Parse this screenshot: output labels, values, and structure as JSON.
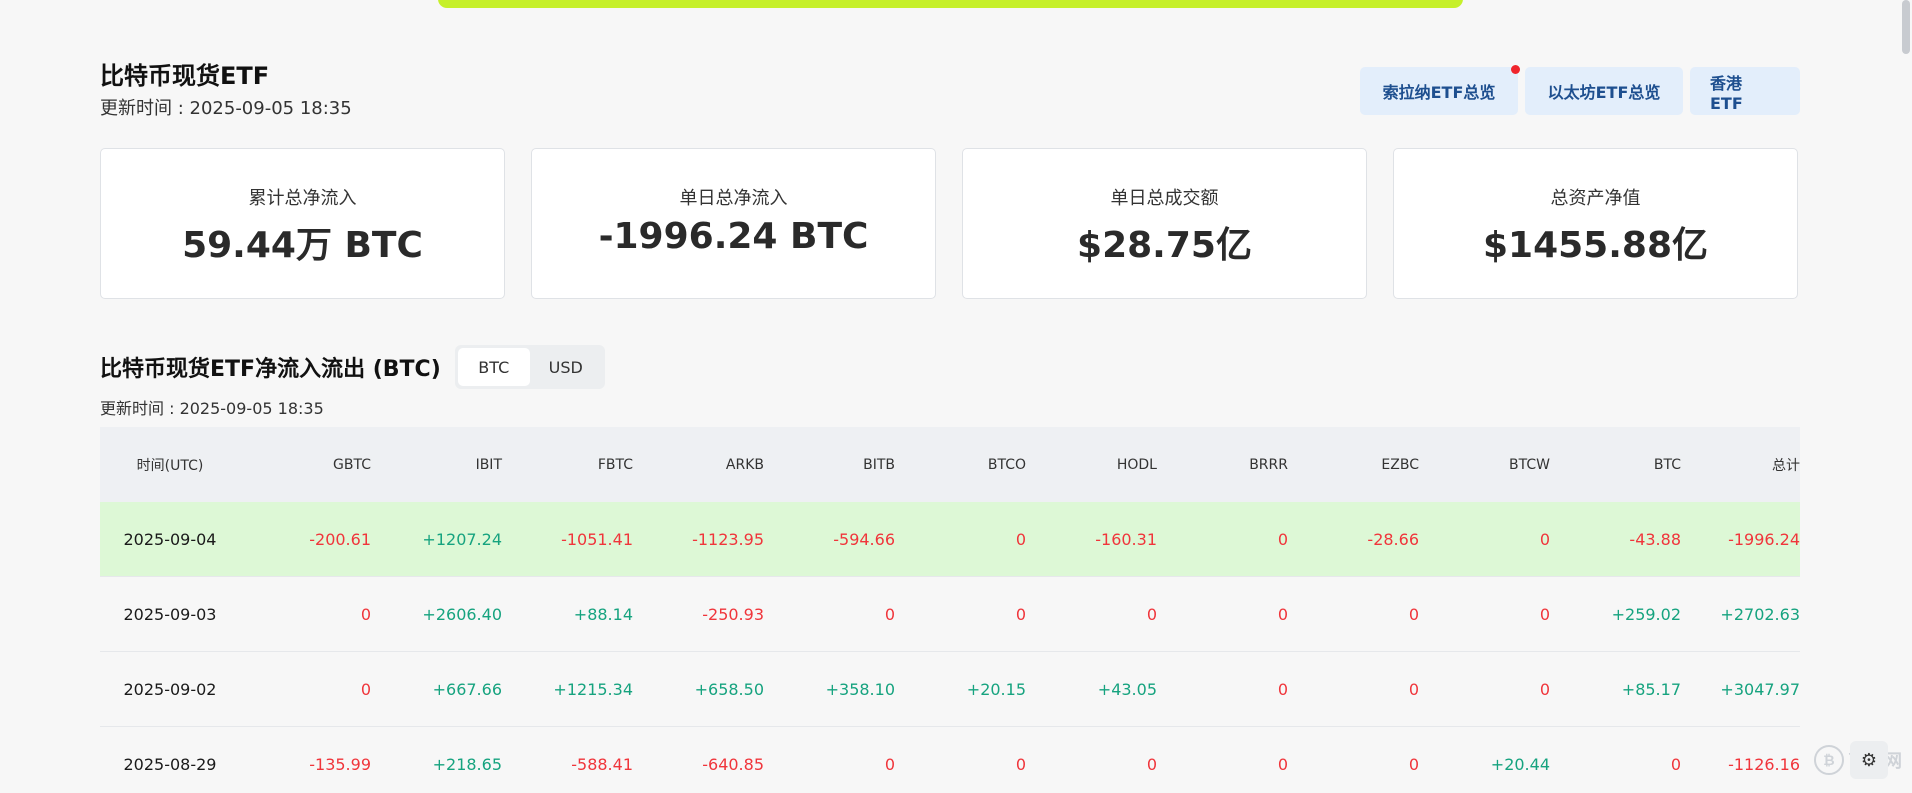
{
  "header": {
    "title": "比特币现货ETF",
    "update_time": "更新时间 : 2025-09-05 18:35"
  },
  "nav": {
    "solana": "索拉纳ETF总览",
    "ethereum": "以太坊ETF总览",
    "hongkong": "香港 ETF"
  },
  "stats": [
    {
      "label": "累计总净流入",
      "value": "59.44万 BTC"
    },
    {
      "label": "单日总净流入",
      "value": "-1996.24 BTC"
    },
    {
      "label": "单日总成交额",
      "value": "$28.75亿"
    },
    {
      "label": "总资产净值",
      "value": "$1455.88亿"
    }
  ],
  "section": {
    "title": "比特币现货ETF净流入流出 (BTC)",
    "toggle_btc": "BTC",
    "toggle_usd": "USD",
    "update_time": "更新时间 : 2025-09-05 18:35"
  },
  "table": {
    "headers": [
      "时间(UTC)",
      "GBTC",
      "IBIT",
      "FBTC",
      "ARKB",
      "BITB",
      "BTCO",
      "HODL",
      "BRRR",
      "EZBC",
      "BTCW",
      "BTC",
      "总计"
    ],
    "rows": [
      [
        "2025-09-04",
        "-200.61",
        "+1207.24",
        "-1051.41",
        "-1123.95",
        "-594.66",
        "0",
        "-160.31",
        "0",
        "-28.66",
        "0",
        "-43.88",
        "-1996.24"
      ],
      [
        "2025-09-03",
        "0",
        "+2606.40",
        "+88.14",
        "-250.93",
        "0",
        "0",
        "0",
        "0",
        "0",
        "0",
        "+259.02",
        "+2702.63"
      ],
      [
        "2025-09-02",
        "0",
        "+667.66",
        "+1215.34",
        "+658.50",
        "+358.10",
        "+20.15",
        "+43.05",
        "0",
        "0",
        "0",
        "+85.17",
        "+3047.97"
      ],
      [
        "2025-08-29",
        "-135.99",
        "+218.65",
        "-588.41",
        "-640.85",
        "0",
        "0",
        "0",
        "0",
        "0",
        "+20.44",
        "0",
        "-1126.16"
      ]
    ]
  },
  "watermark": {
    "text": "币界网",
    "icon": "coin-icon"
  },
  "colors": {
    "positive": "#16a37f",
    "negative": "#f0353b",
    "highlight_row": "#ddf8d6",
    "top_bar": "#c6f02a",
    "nav_button_bg": "#e3eefb"
  }
}
